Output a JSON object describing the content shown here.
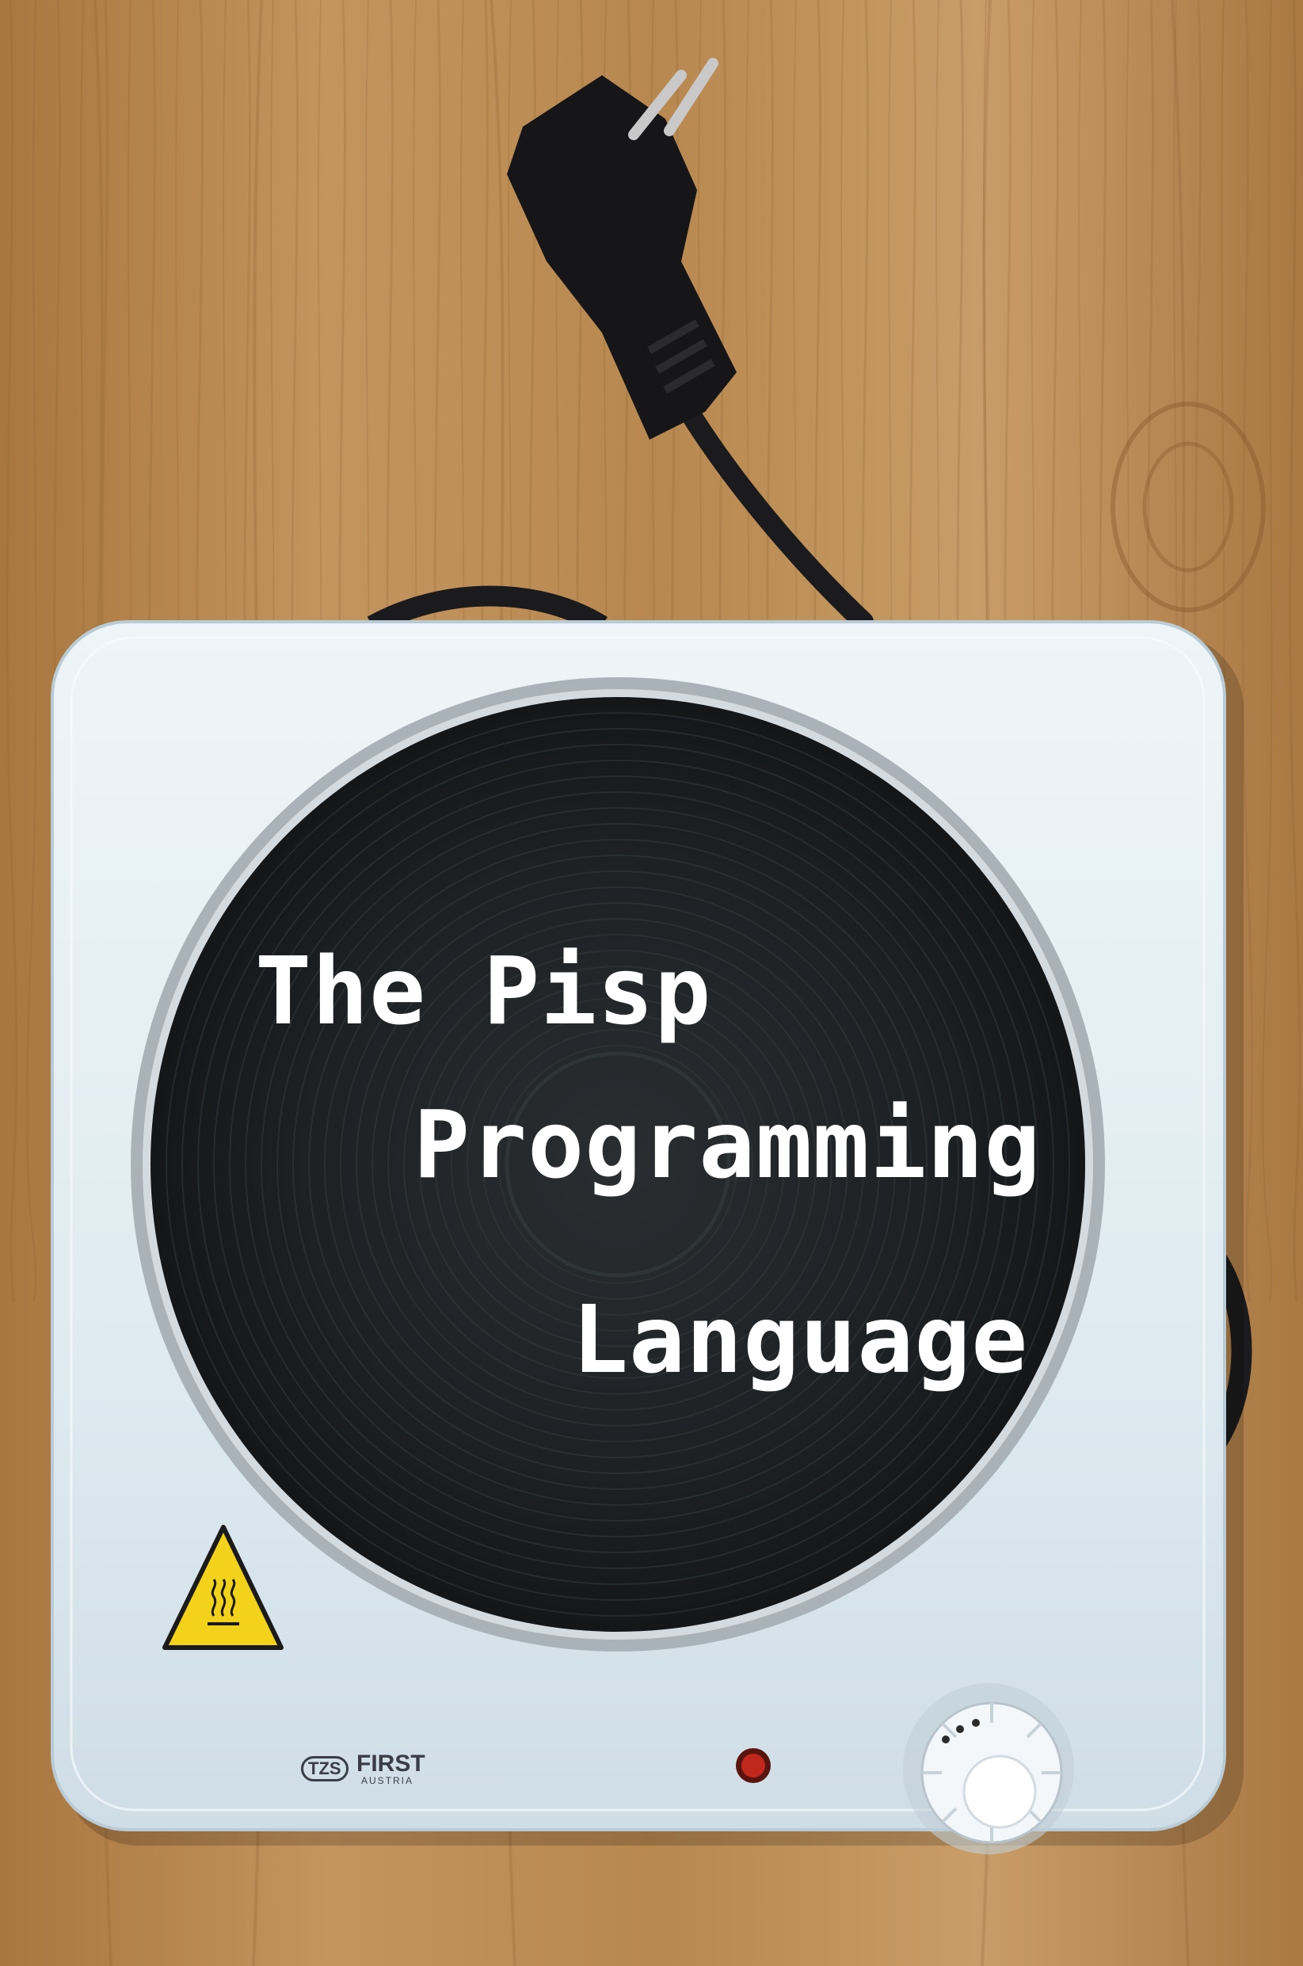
{
  "cover": {
    "title_lines": [
      "The Pisp",
      "Programming",
      "Language"
    ],
    "brand": {
      "badge": "TZS",
      "name": "FIRST",
      "sub": "AUSTRIA"
    }
  },
  "colors": {
    "wood": "#b98a55",
    "plate_body": "#e3eef3",
    "burner": "#1c1f21",
    "title_text": "#ffffff",
    "warning_yellow": "#f2d21b",
    "indicator_red": "#c0281c"
  },
  "icons": {
    "warning": "hot-surface-warning-icon",
    "knob": "temperature-knob",
    "light": "power-indicator-light",
    "plug": "power-plug"
  }
}
